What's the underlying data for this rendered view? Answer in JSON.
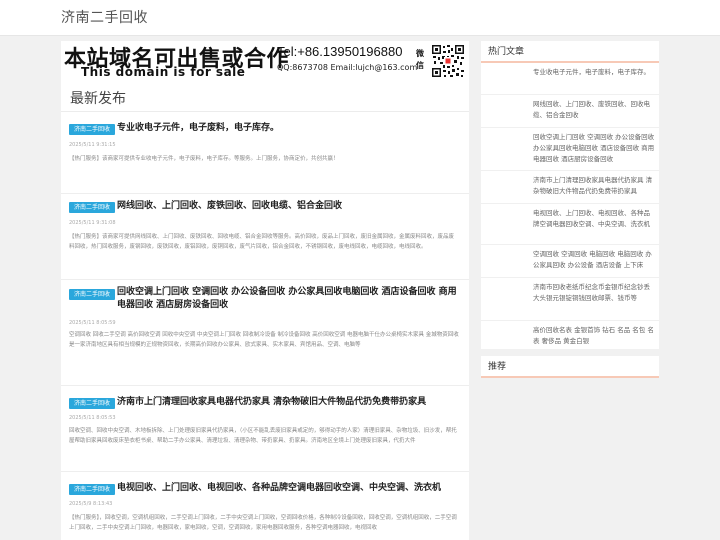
{
  "site": {
    "title": "济南二手回收"
  },
  "banner": {
    "cn": "本站域名可出售或合作",
    "en": "This domain is for sale",
    "tel": "Tel:+86.13950196880",
    "qq": "QQ:8673708 Email:lujch@163.com",
    "wechat": "微信"
  },
  "main": {
    "section_title": "最新发布"
  },
  "posts": [
    {
      "tag": "济南二手回收",
      "title": "专业收电子元件，电子废料，电子库存。",
      "date": "2025/5/11 9:31:15",
      "excerpt": "【热门服务】该商家可提供专业收电子元件，电子废料，电子库存。等服务。上门服务，协商定价，共创共赢！"
    },
    {
      "tag": "济南二手回收",
      "title": "网线回收、上门回收、废铁回收、回收电缆、铝合金回收",
      "date": "2025/5/11 9:31:08",
      "excerpt": "【热门服务】该商家可提供网线回收、上门回收、废铁回收、回收电缆、铝合金回收等服务。高价回收，废品上门回收，废旧金属回收，金属废料回收，废品废料回收，热门回收服务，废钢回收，废铁回收，废铝回收，废铜回收，废气片回收，铝合金回收，不锈钢回收，废电线回收，电缆回收，电线回收。"
    },
    {
      "tag": "济南二手回收",
      "title": "回收空调上门回收 空调回收 办公设备回收 办公家具回收电脑回收 酒店设备回收 商用电器回收 酒店厨房设备回收",
      "date": "2025/5/11 8:05:59",
      "excerpt": "空调回收 回收二手空调 高价回收空调 回收中央空调 中央空调上门回收 回收制冷设备 制冷设备回收 高价回收空调 电器电脑干仕办公桌椅实木家具 金城物资回收是一家济南地区具有相当规模的正规物资回收，长期高价回收办公家具、欧式家具、实木家具、宾馆用品、空调、电脑等"
    },
    {
      "tag": "济南二手回收",
      "title": "济南市上门清理回收家具电器代扔家具 清杂物破旧大件物品代扔免费带扔家具",
      "date": "2025/5/11 8:05:53",
      "excerpt": "回收空调、回收中央空调、木地板拆除、上门处理废旧家具代扔家具，（小区不能乱丢废旧家具或定的，够得动手的人家）清理旧家具、杂物垃圾、旧沙发，帮托屋帮助旧家具回收废床垫衣柜书桌、帮助二手办公家具、清理垃圾、清理杂物、带扔家具、扔家具。济南地区全境上门处理废旧家具，代扔大件"
    },
    {
      "tag": "济南二手回收",
      "title": "电视回收、上门回收、电视回收、各种品牌空调电器回收空调、中央空调、洗衣机",
      "date": "2025/5/9 8:13:43",
      "excerpt": "【热门服务】，回收空调，空调机组回收，二手空调上门回收，二手中央空调上门回收，空调回收价格，各种制冷设备回收，回收空调，空调机组回收，二手空调上门回收，二手中央空调上门回收，电器回收，家电回收，空调，空调回收，家用电器回收服务，各种空调电器回收，电视回收"
    }
  ],
  "sidebar": {
    "hot_title": "热门文章",
    "hot": [
      "专业收电子元件，电子废料，电子库存。",
      "网线回收、上门回收、废铁回收、回收电缆、铝合金回收",
      "回收空调上门回收 空调回收 办公设备回收 办公家具回收电脑回收 酒店设备回收 商用电器回收 酒店厨房设备回收",
      "济南市上门清理回收家具电器代扔家具 清杂物破旧大件物品代扔免费带扔家具",
      "电视回收、上门回收、电视回收、各种品牌空调电器回收空调、中央空调、洗衣机",
      "空调回收 空调回收 电脑回收 电脑回收 办公家具回收 办公设备 酒店设备 上下床",
      "济南市回收老纸币纪念币金银币纪念钞丢大头银元银锭铜钱回收邮票、钱币等",
      "高价回收名表 金银首饰 钻石 名品 名包 名表 奢侈品 黄金白银"
    ],
    "rec_title": "推荐"
  }
}
